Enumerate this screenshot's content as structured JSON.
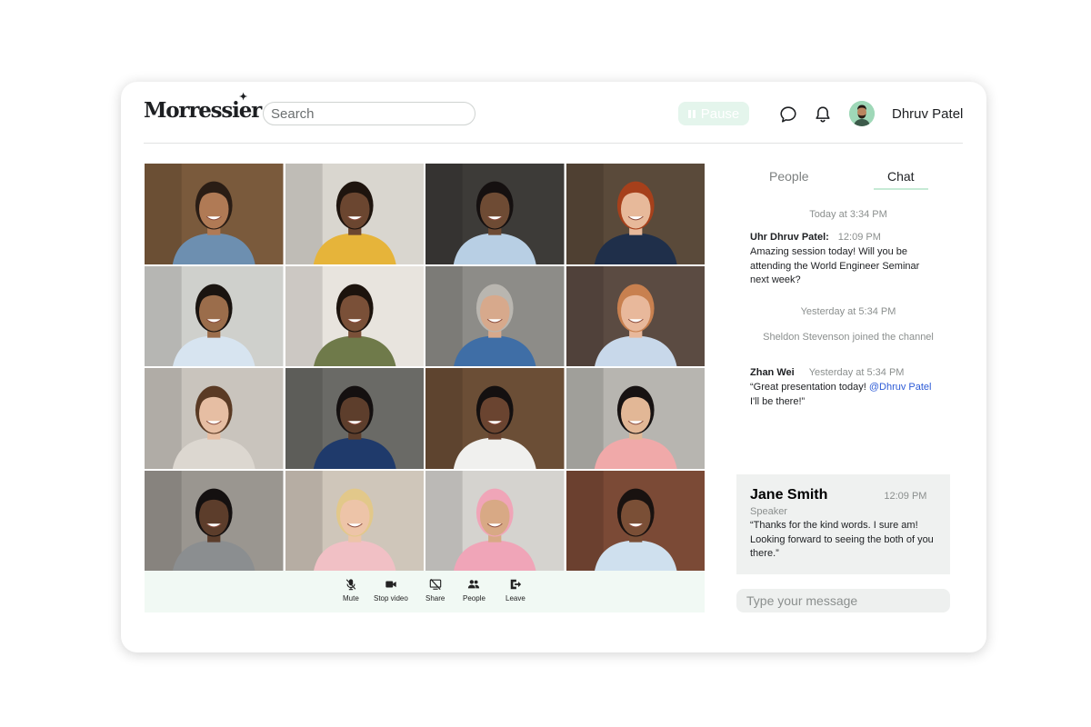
{
  "header": {
    "logo": "Morressier",
    "search_placeholder": "Search",
    "pause_label": "Pause",
    "user_name": "Dhruv Patel"
  },
  "participants": [
    {
      "bg": "#7a5a3c",
      "skin": "#b07a55",
      "hair": "#2a1d15",
      "shirt": "#6d8fb0"
    },
    {
      "bg": "#d9d6cf",
      "skin": "#6b4630",
      "hair": "#1e140e",
      "shirt": "#e6b43a"
    },
    {
      "bg": "#3d3b38",
      "skin": "#6e4b34",
      "hair": "#151010",
      "shirt": "#b8cfe4"
    },
    {
      "bg": "#5a4a3a",
      "skin": "#e7b99a",
      "hair": "#a6401b",
      "shirt": "#1f2f4a"
    },
    {
      "bg": "#cfd0cc",
      "skin": "#9b6d4b",
      "hair": "#1a1410",
      "shirt": "#d7e4f0"
    },
    {
      "bg": "#e8e4de",
      "skin": "#7a5038",
      "hair": "#1c130d",
      "shirt": "#6f7a4a"
    },
    {
      "bg": "#8d8c88",
      "skin": "#d7a98c",
      "hair": "#b9b6b0",
      "shirt": "#3f6ea6"
    },
    {
      "bg": "#5b4b42",
      "skin": "#e8b89b",
      "hair": "#c8804f",
      "shirt": "#c8d8ea"
    },
    {
      "bg": "#c9c4bd",
      "skin": "#e6bea3",
      "hair": "#5a3a24",
      "shirt": "#dcd7d0"
    },
    {
      "bg": "#6a6a66",
      "skin": "#5d3e2c",
      "hair": "#141010",
      "shirt": "#1f3a6b"
    },
    {
      "bg": "#6b4e36",
      "skin": "#6a4430",
      "hair": "#141010",
      "shirt": "#f0f0ee"
    },
    {
      "bg": "#b7b5b0",
      "skin": "#e2b796",
      "hair": "#171212",
      "shirt": "#f0a9a9"
    },
    {
      "bg": "#9a9690",
      "skin": "#5c3d2b",
      "hair": "#141010",
      "shirt": "#8b8e90"
    },
    {
      "bg": "#cfc6ba",
      "skin": "#edc4a8",
      "hair": "#e2c88a",
      "shirt": "#f1c0c5"
    },
    {
      "bg": "#d5d3cf",
      "skin": "#d8a985",
      "hair": "#f0a5b8",
      "shirt": "#f0a5b8"
    },
    {
      "bg": "#7b4a36",
      "skin": "#7a4f36",
      "hair": "#191210",
      "shirt": "#cfe0ee"
    }
  ],
  "toolbar": {
    "mute": "Mute",
    "stop_video": "Stop video",
    "share": "Share",
    "people": "People",
    "leave": "Leave"
  },
  "tabs": {
    "people": "People",
    "chat": "Chat"
  },
  "chat": {
    "ts1": "Today at 3:34 PM",
    "msg1_author": "Uhr Dhruv Patel:",
    "msg1_time": "12:09 PM",
    "msg1_text": "Amazing session today! Will you be attending the World Engineer Seminar next week?",
    "ts2": "Yesterday at 5:34 PM",
    "system": "Sheldon Stevenson joined the channel",
    "msg2_author": "Zhan Wei",
    "msg2_time": "Yesterday at 5:34 PM",
    "msg2_text_pre": "“Great presentation today! ",
    "msg2_mention": "@Dhruv Patel",
    "msg2_text_post": " I'll be there!”",
    "reply_author": "Jane Smith",
    "reply_time": "12:09 PM",
    "reply_role": "Speaker",
    "reply_text": "“Thanks for the kind words. I sure am! Looking forward to seeing the both of you there.”",
    "input_placeholder": "Type your message"
  },
  "colors": {
    "accent_green": "#c6ead5",
    "toolbar_bg": "#f1f9f4",
    "mention": "#2d5bd6"
  }
}
